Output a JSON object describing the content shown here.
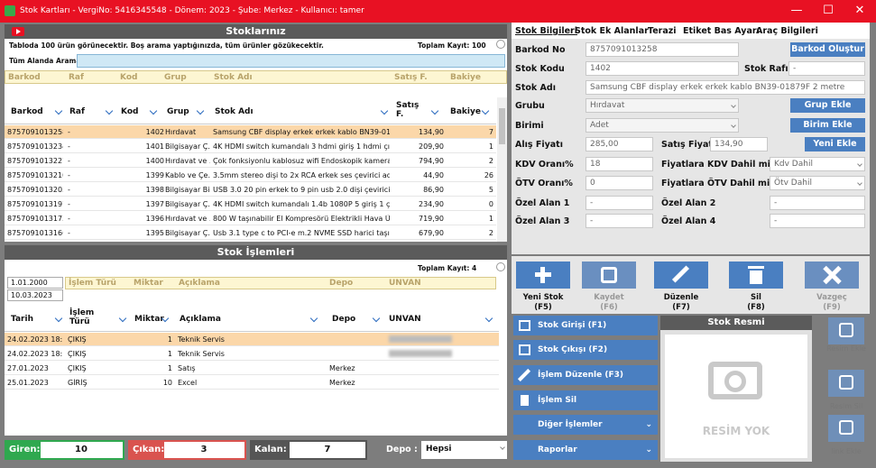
{
  "window": {
    "title": "Stok Kartları - VergiNo: 5416345548 - Dönem: 2023 - Şube: Merkez - Kullanıcı: tamer",
    "min": "—",
    "max": "☐",
    "close": "✕"
  },
  "stoklar": {
    "title": "Stoklarınız",
    "info": "Tabloda 100 ürün görünecektir. Boş arama yaptığınızda, tüm ürünler gözükecektir.",
    "total": "Toplam Kayıt:  100",
    "search_label": "Tüm Alanda Arama",
    "filter_headers": [
      "Barkod",
      "Raf",
      "Kod",
      "Grup",
      "Stok Adı",
      "Satış F.",
      "Bakiye"
    ],
    "columns": [
      "Barkod",
      "Raf",
      "Kod",
      "Grup",
      "Stok Adı",
      "Satış F.",
      "Bakiye"
    ],
    "rows": [
      {
        "barkod": "8757091013258",
        "raf": "-",
        "kod": "1402",
        "grup": "Hırdavat",
        "ad": "Samsung  CBF display erkek erkek kablo BN39-01879F...",
        "fiyat": "134,90",
        "bakiye": "7"
      },
      {
        "barkod": "8757091013234",
        "raf": "-",
        "kod": "1401",
        "grup": "Bilgisayar Ç...",
        "ad": "4K HDMI switch kumandalı 3 hdmi giriş 1 hdmi çıkış ulb...",
        "fiyat": "209,90",
        "bakiye": "1"
      },
      {
        "barkod": "8757091013227",
        "raf": "-",
        "kod": "1400",
        "grup": "Hırdavat ve ...",
        "ad": "Çok fonksiyonlu kablosuz wifi Endoskopik kamera 10m",
        "fiyat": "794,90",
        "bakiye": "2"
      },
      {
        "barkod": "8757091013210",
        "raf": "-",
        "kod": "1399",
        "grup": "Kablo ve Çe...",
        "ad": "3.5mm stereo dişi to 2x RCA erkek ses çevirici adaptör",
        "fiyat": "44,90",
        "bakiye": "26"
      },
      {
        "barkod": "8757091013203",
        "raf": "-",
        "kod": "1398",
        "grup": "Bilgisayar Bil...",
        "ad": "USB 3.0 20 pin erkek to 9 pin usb 2.0 dişi çevirici kablo",
        "fiyat": "86,90",
        "bakiye": "5"
      },
      {
        "barkod": "8757091013197",
        "raf": "-",
        "kod": "1397",
        "grup": "Bilgisayar Ç...",
        "ad": "4K HDMI switch kumandalı 1.4b 1080P 5 giriş 1 çıkış ult...",
        "fiyat": "234,90",
        "bakiye": "0"
      },
      {
        "barkod": "8757091013173",
        "raf": "-",
        "kod": "1396",
        "grup": "Hırdavat ve ...",
        "ad": "800 W taşınabilir El Kompresörü Elektrikli Hava Üfleme ...",
        "fiyat": "719,90",
        "bakiye": "1"
      },
      {
        "barkod": "8757091013166",
        "raf": "-",
        "kod": "1395",
        "grup": "Bilgisayar Ç...",
        "ad": "Usb 3.1 type c to PCI-e m.2 NVME SSD harici taşınabilir...",
        "fiyat": "679,90",
        "bakiye": "2"
      }
    ]
  },
  "islemler": {
    "title": "Stok İşlemleri",
    "total": "Toplam Kayıt:  4",
    "date1": "1.01.2000",
    "date2": "10.03.2023",
    "filter_headers": [
      "İşlem Türü",
      "Miktar",
      "Açıklama",
      "Depo",
      "UNVAN"
    ],
    "columns": [
      "Tarih",
      "İşlem Türü",
      "Miktar",
      "Açıklama",
      "Depo",
      "UNVAN"
    ],
    "rows": [
      {
        "tarih": "24.02.2023 18:...",
        "tur": "ÇIKIŞ",
        "miktar": "1",
        "aciklama": "Teknik Servis",
        "depo": "",
        "unvan": ""
      },
      {
        "tarih": "24.02.2023 18:...",
        "tur": "ÇIKIŞ",
        "miktar": "1",
        "aciklama": "Teknik Servis",
        "depo": "",
        "unvan": ""
      },
      {
        "tarih": "27.01.2023",
        "tur": "ÇIKIŞ",
        "miktar": "1",
        "aciklama": "Satış",
        "depo": "Merkez",
        "unvan": ""
      },
      {
        "tarih": "25.01.2023",
        "tur": "GİRİŞ",
        "miktar": "10",
        "aciklama": "Excel",
        "depo": "Merkez",
        "unvan": ""
      }
    ]
  },
  "footer": {
    "giren_label": "Giren:",
    "giren": "10",
    "cikan_label": "Çıkan:",
    "cikan": "3",
    "kalan_label": "Kalan:",
    "kalan": "7",
    "depo_label": "Depo :",
    "depo": "Hepsi"
  },
  "tabs": [
    "Stok Bilgileri",
    "Stok Ek Alanlar",
    "Terazi",
    "Etiket Bas Ayarı",
    "Araç Bilgileri"
  ],
  "form": {
    "barkod_label": "Barkod No",
    "barkod": "8757091013258",
    "barkod_btn": "Barkod Oluştur",
    "kod_label": "Stok Kodu",
    "kod": "1402",
    "raf_label": "Stok Rafı",
    "raf": "-",
    "ad_label": "Stok Adı",
    "ad": "Samsung  CBF display erkek erkek kablo BN39-01879F 2 metre",
    "grup_label": "Grubu",
    "grup": "Hırdavat",
    "grup_btn": "Grup Ekle",
    "birim_label": "Birimi",
    "birim": "Adet",
    "birim_btn": "Birim Ekle",
    "alis_label": "Alış Fiyatı",
    "alis": "285,00",
    "satis_label": "Satış Fiyatı",
    "satis": "134,90",
    "yeni_btn": "Yeni Ekle",
    "kdv_label": "KDV Oranı%",
    "kdv": "18",
    "kdv_dahil_label": "Fiyatlara KDV Dahil mi?",
    "kdv_dahil": "Kdv Dahil",
    "otv_label": "ÖTV Oranı%",
    "otv": "0",
    "otv_dahil_label": "Fiyatlara ÖTV Dahil mi?",
    "otv_dahil": "Ötv Dahil",
    "ozel1_label": "Özel Alan 1",
    "ozel1": "-",
    "ozel2_label": "Özel Alan 2",
    "ozel2": "-",
    "ozel3_label": "Özel Alan 3",
    "ozel3": "-",
    "ozel4_label": "Özel Alan 4",
    "ozel4": "-"
  },
  "toolbar": {
    "yeni": "Yeni Stok",
    "yeni_key": "(F5)",
    "kaydet": "Kaydet",
    "kaydet_key": "(F6)",
    "duzenle": "Düzenle",
    "duzenle_key": "(F7)",
    "sil": "Sil",
    "sil_key": "(F8)",
    "vazgec": "Vazgeç",
    "vazgec_key": "(F9)"
  },
  "actions": {
    "giris": "Stok Girişi (F1)",
    "cikis": "Stok Çıkışı (F2)",
    "duzenle": "İşlem Düzenle (F3)",
    "sil": "İşlem Sil",
    "diger": "Diğer İşlemler",
    "raporlar": "Raporlar"
  },
  "resim": {
    "title": "Stok Resmi",
    "none": "RESİM YOK",
    "ekle": "Resim Ekle",
    "sil": "Resim Sil",
    "link": "link Ekle"
  },
  "colors": {
    "title_bar": "#e81123",
    "accent": "#4a7fc1",
    "selected_row": "#fbd7a9",
    "filter_bg": "#fdf6d2",
    "giren": "#2fa84f",
    "cikan": "#d9534f"
  }
}
